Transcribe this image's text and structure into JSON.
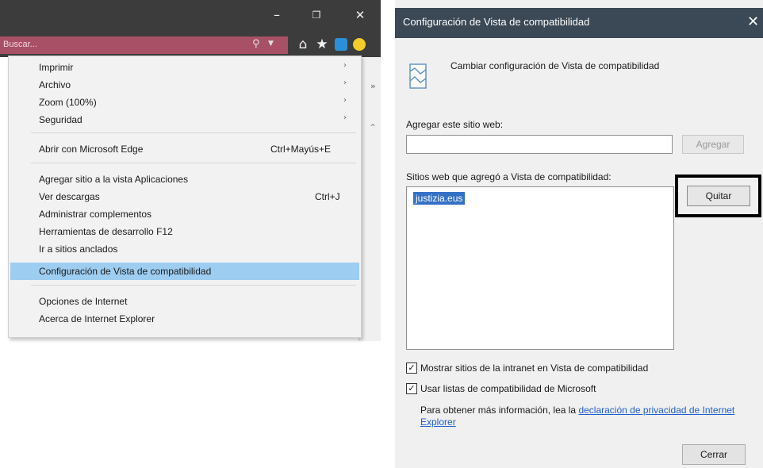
{
  "ie_window": {
    "search_placeholder": "Buscar..."
  },
  "menu": {
    "items": [
      {
        "label": "Imprimir",
        "shortcut": "",
        "submenu": true
      },
      {
        "label": "Archivo",
        "shortcut": "",
        "submenu": true
      },
      {
        "label": "Zoom (100%)",
        "shortcut": "",
        "submenu": true
      },
      {
        "label": "Seguridad",
        "shortcut": "",
        "submenu": true
      },
      {
        "label": "Abrir con Microsoft Edge",
        "shortcut": "Ctrl+Mayús+E",
        "submenu": false
      },
      {
        "label": "Agregar sitio a la vista Aplicaciones",
        "shortcut": "",
        "submenu": false
      },
      {
        "label": "Ver descargas",
        "shortcut": "Ctrl+J",
        "submenu": false
      },
      {
        "label": "Administrar complementos",
        "shortcut": "",
        "submenu": false
      },
      {
        "label": "Herramientas de desarrollo F12",
        "shortcut": "",
        "submenu": false
      },
      {
        "label": "Ir a sitios anclados",
        "shortcut": "",
        "submenu": false
      },
      {
        "label": "Configuración de Vista de compatibilidad",
        "shortcut": "",
        "submenu": false,
        "highlighted": true
      },
      {
        "label": "Opciones de Internet",
        "shortcut": "",
        "submenu": false
      },
      {
        "label": "Acerca de Internet Explorer",
        "shortcut": "",
        "submenu": false
      }
    ]
  },
  "dialog": {
    "title": "Configuración de Vista de compatibilidad",
    "header_text": "Cambiar configuración de Vista de compatibilidad",
    "add_label": "Agregar este sitio web:",
    "add_value": "",
    "add_button": "Agregar",
    "sites_label": "Sitios web que agregó a Vista de compatibilidad:",
    "sites": [
      "justizia.eus"
    ],
    "remove_button": "Quitar",
    "checkbox_intranet": {
      "label": "Mostrar sitios de la intranet en Vista de compatibilidad",
      "checked": true
    },
    "checkbox_ms_lists": {
      "label": "Usar listas de compatibilidad de Microsoft",
      "checked": true
    },
    "info_text": "Para obtener más información, lea la",
    "info_link": "declaración de privacidad de Internet Explorer",
    "close_button": "Cerrar"
  },
  "colors": {
    "titlebar": "#3c3c3c",
    "search_box": "#a85066",
    "menu_highlight": "#9dcdf1",
    "dialog_titlebar": "#3b4855",
    "selection": "#3470c6",
    "link": "#1f5fd0"
  }
}
